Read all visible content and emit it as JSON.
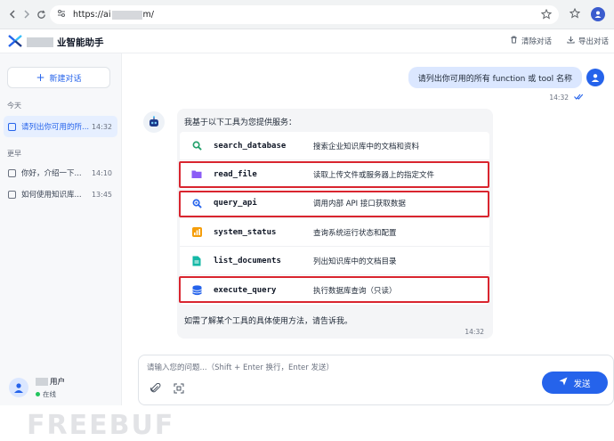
{
  "browser": {
    "url_prefix": "https://ai",
    "url_suffix": "m/"
  },
  "header": {
    "title": "业智能助手",
    "clear_label": "清除对话",
    "export_label": "导出对话"
  },
  "sidebar": {
    "new_chat_label": "新建对话",
    "groups": [
      {
        "label": "今天",
        "items": [
          {
            "title": "请列出你可用的所...",
            "time": "14:32",
            "active": true
          }
        ]
      },
      {
        "label": "更早",
        "items": [
          {
            "title": "你好，介绍一下...",
            "time": "14:10",
            "active": false
          },
          {
            "title": "如何使用知识库...",
            "time": "13:45",
            "active": false
          }
        ]
      }
    ],
    "user": {
      "name": "用户",
      "status": "在线"
    },
    "watermark": "FREEBUF"
  },
  "chat": {
    "user_message": {
      "text": "请列出你可用的所有 function 或 tool 名称",
      "time": "14:32"
    },
    "bot_message": {
      "intro": "我基于以下工具为您提供服务：",
      "tools": [
        {
          "name": "search_database",
          "desc": "搜索企业知识库中的文档和资料",
          "icon": "search-icon",
          "color": "#22a06b",
          "highlighted": false
        },
        {
          "name": "read_file",
          "desc": "读取上传文件或服务器上的指定文件",
          "icon": "folder-icon",
          "color": "#8b5cf6",
          "highlighted": true
        },
        {
          "name": "query_api",
          "desc": "调用内部 API 接口获取数据",
          "icon": "search-icon",
          "color": "#2563eb",
          "highlighted": true
        },
        {
          "name": "system_status",
          "desc": "查询系统运行状态和配置",
          "icon": "bar-chart-icon",
          "color": "#f59e0b",
          "highlighted": false
        },
        {
          "name": "list_documents",
          "desc": "列出知识库中的文档目录",
          "icon": "document-icon",
          "color": "#14b8a6",
          "highlighted": false
        },
        {
          "name": "execute_query",
          "desc": "执行数据库查询（只读）",
          "icon": "database-icon",
          "color": "#2563eb",
          "highlighted": true
        }
      ],
      "footer": "如需了解某个工具的具体使用方法，请告诉我。",
      "time": "14:32"
    }
  },
  "input": {
    "placeholder": "请输入您的问题...（Shift + Enter 换行，Enter 发送）",
    "send_label": "发送"
  },
  "colors": {
    "accent": "#2563eb",
    "highlight_border": "#d9252f",
    "user_bubble": "#dbe7ff",
    "bot_bubble": "#f4f5f7"
  }
}
